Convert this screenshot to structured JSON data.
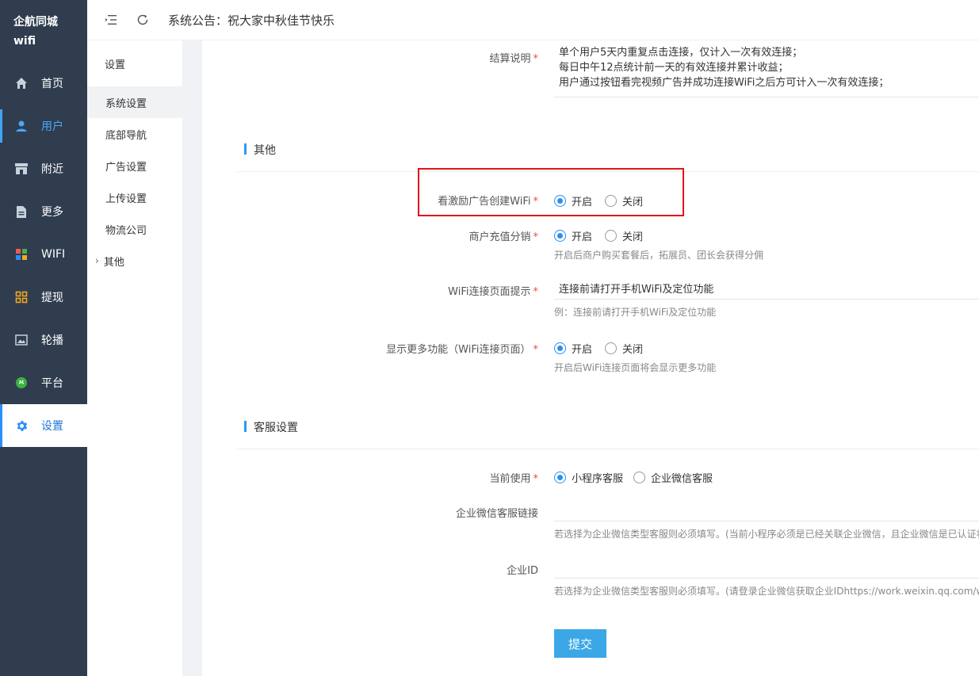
{
  "brand": {
    "line1": "企航同城",
    "line2": "wifi"
  },
  "nav": [
    {
      "label": "首页",
      "icon": "home-icon"
    },
    {
      "label": "用户",
      "icon": "user-icon"
    },
    {
      "label": "附近",
      "icon": "store-icon"
    },
    {
      "label": "更多",
      "icon": "document-icon"
    },
    {
      "label": "WIFI",
      "icon": "apps-icon"
    },
    {
      "label": "提现",
      "icon": "grid-icon"
    },
    {
      "label": "轮播",
      "icon": "image-icon"
    },
    {
      "label": "平台",
      "icon": "platform-icon"
    },
    {
      "label": "设置",
      "icon": "gear-icon"
    }
  ],
  "header": {
    "announcement": "系统公告：祝大家中秋佳节快乐"
  },
  "submenu": {
    "title": "设置",
    "items": [
      "系统设置",
      "底部导航",
      "广告设置",
      "上传设置",
      "物流公司",
      "其他"
    ]
  },
  "settlement": {
    "label": "结算说明",
    "required": "*",
    "lines": [
      "单个用户5天内重复点击连接，仅计入一次有效连接；",
      "每日中午12点统计前一天的有效连接并累计收益；",
      "用户通过按钮看完视频广告并成功连接WiFi之后方可计入一次有效连接；"
    ]
  },
  "section_other": {
    "title": "其他"
  },
  "reward_ad": {
    "label": "看激励广告创建WiFi",
    "required": "*",
    "on": "开启",
    "off": "关闭"
  },
  "merchant_recharge": {
    "label": "商户充值分销",
    "required": "*",
    "on": "开启",
    "off": "关闭",
    "hint": "开启后商户购买套餐后，拓展员、团长会获得分佣"
  },
  "wifi_tip": {
    "label": "WiFi连接页面提示",
    "required": "*",
    "value": "连接前请打开手机WiFi及定位功能",
    "hint": "例：连接前请打开手机WiFi及定位功能"
  },
  "more_features": {
    "label": "显示更多功能（WiFi连接页面）",
    "required": "*",
    "on": "开启",
    "off": "关闭",
    "hint": "开启后WiFi连接页面将会显示更多功能"
  },
  "section_service": {
    "title": "客服设置"
  },
  "current_use": {
    "label": "当前使用",
    "required": "*",
    "opt1": "小程序客服",
    "opt2": "企业微信客服"
  },
  "wework_link": {
    "label": "企业微信客服链接",
    "hint": "若选择为企业微信类型客服则必须填写。(当前小程序必须是已经关联企业微信，且企业微信是已认证状"
  },
  "corp_id": {
    "label": "企业ID",
    "hint": "若选择为企业微信类型客服则必须填写。(请登录企业微信获取企业IDhttps://work.weixin.qq.com/wew"
  },
  "submit": {
    "label": "提交"
  },
  "colors": {
    "sidebar": "#2f3d4f",
    "accent": "#2b8ef0",
    "submit": "#3ba7e6",
    "highlight": "#e0141b"
  }
}
